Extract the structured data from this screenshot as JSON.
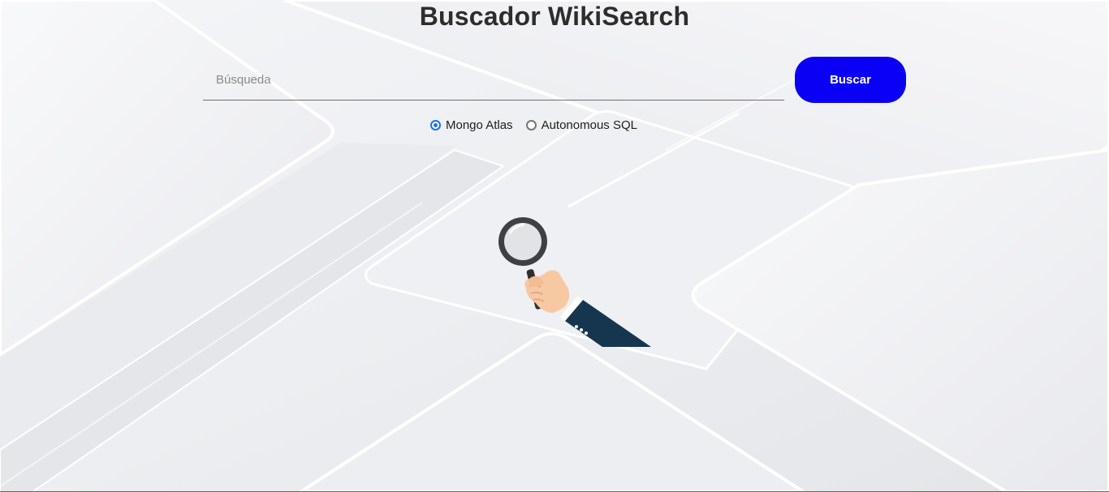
{
  "header": {
    "title": "Buscador WikiSearch"
  },
  "search": {
    "placeholder": "Búsqueda",
    "value": "",
    "button_label": "Buscar"
  },
  "database_options": [
    {
      "label": "Mongo Atlas",
      "selected": true
    },
    {
      "label": "Autonomous SQL",
      "selected": false
    }
  ],
  "colors": {
    "accent": "#0a00f5",
    "radio_selected": "#1a73e8",
    "title": "#2d2d2d",
    "background": "#eceef2"
  },
  "illustration": {
    "icon": "hand-holding-magnifier-icon"
  }
}
